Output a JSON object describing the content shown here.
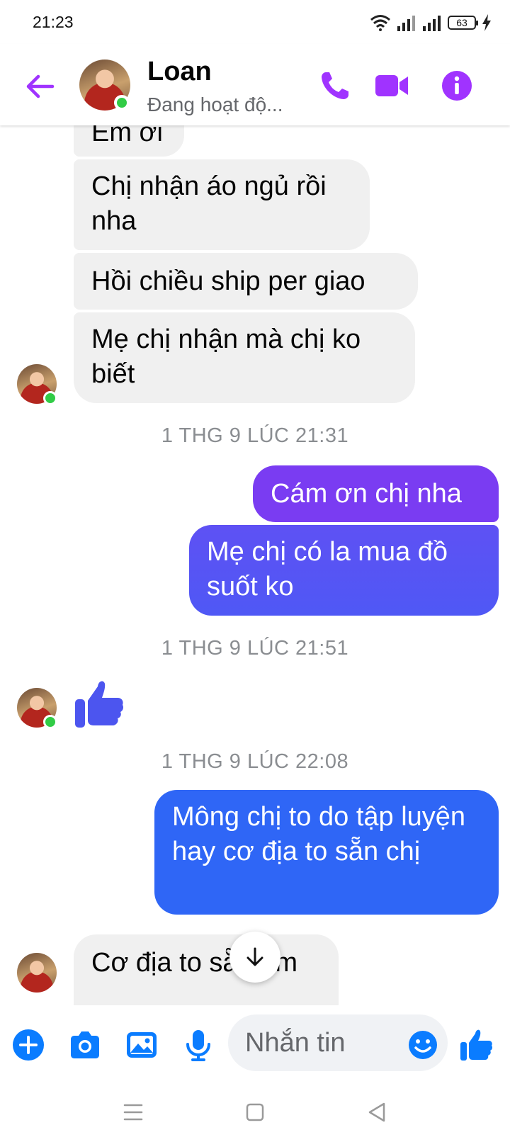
{
  "status_bar": {
    "time": "21:23",
    "battery": "63"
  },
  "header": {
    "contact_name": "Loan",
    "status": "Đang hoạt độ..."
  },
  "messages": [
    {
      "dir": "in",
      "text": "Em ơi"
    },
    {
      "dir": "in",
      "text": "Chị nhận áo ngủ rồi nha"
    },
    {
      "dir": "in",
      "text": "Hồi chiều ship per giao"
    },
    {
      "dir": "in",
      "text": "Mẹ chị nhận mà chị ko biết"
    },
    {
      "timestamp": "1 THG 9 LÚC 21:31"
    },
    {
      "dir": "out",
      "text": "Cám ơn chị nha"
    },
    {
      "dir": "out",
      "text": "Mẹ chị có la mua đồ suốt ko"
    },
    {
      "timestamp": "1 THG 9 LÚC 21:51"
    },
    {
      "dir": "in",
      "type": "like-sticker"
    },
    {
      "timestamp": "1 THG 9 LÚC 22:08"
    },
    {
      "dir": "out",
      "text": "Mông chị to do tập luyện hay cơ địa to sẵn chị"
    },
    {
      "dir": "in",
      "text": "Cơ địa to sẵn em"
    }
  ],
  "composer": {
    "placeholder": "Nhắn tin"
  },
  "icons": {
    "back": "arrow-left-icon",
    "call": "phone-icon",
    "video": "video-camera-icon",
    "info": "info-icon",
    "plus": "plus-circle-icon",
    "camera": "camera-icon",
    "gallery": "image-icon",
    "mic": "microphone-icon",
    "emoji": "emoji-icon",
    "like": "thumbs-up-icon",
    "scroll": "arrow-down-icon"
  },
  "colors": {
    "accent_purple": "#a033ff",
    "out_bubble_top": "#7a3cf2",
    "out_bubble_mid": "#5a55f5",
    "out_bubble_bottom": "#2f66f6",
    "in_bubble": "#f0f0f0",
    "composer_blue": "#0a7cff",
    "online_green": "#31cc46"
  }
}
